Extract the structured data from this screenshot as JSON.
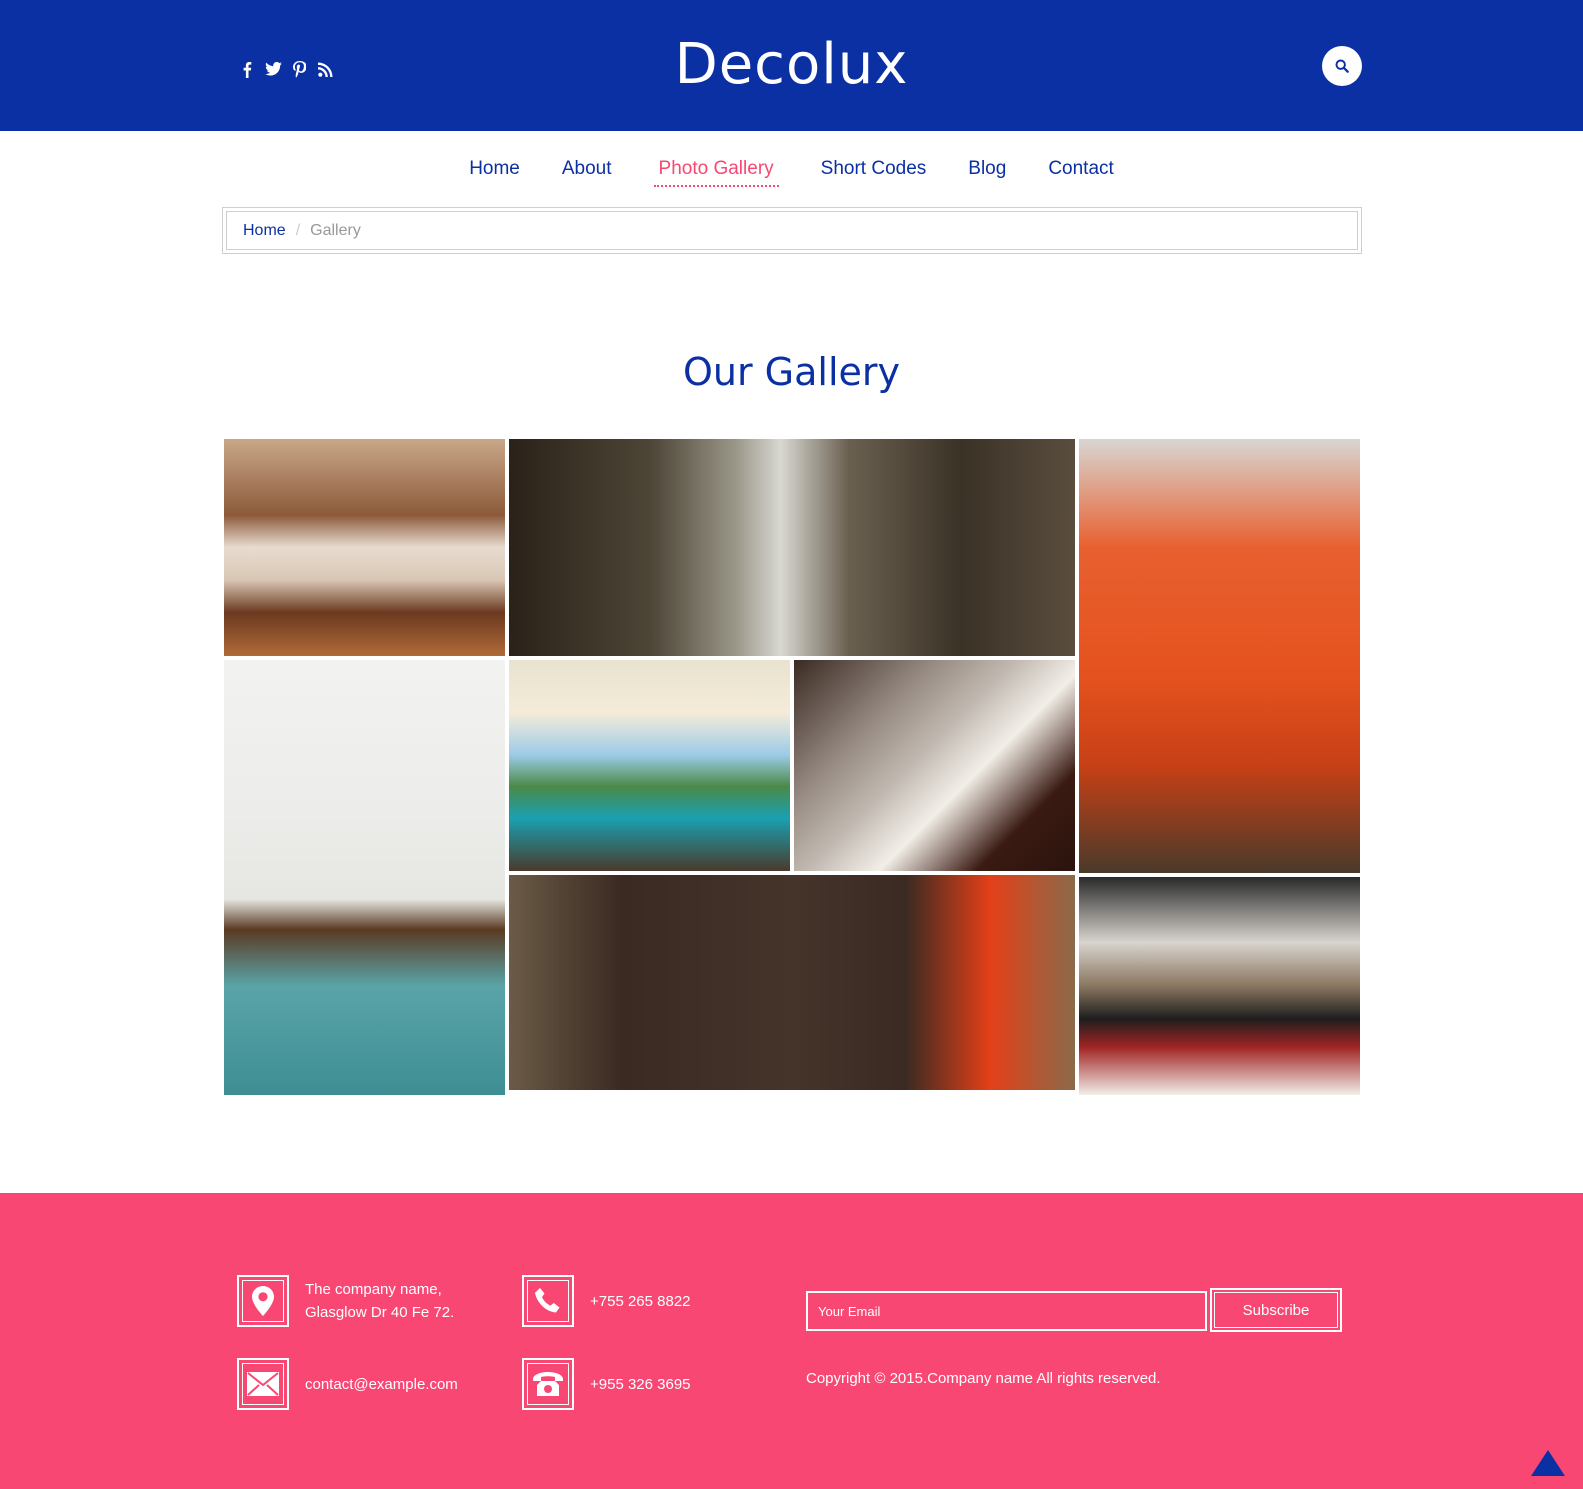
{
  "header": {
    "logo": "Decolux",
    "social": [
      "facebook-icon",
      "twitter-icon",
      "pinterest-icon",
      "rss-icon"
    ],
    "search_icon": "search-icon"
  },
  "nav": {
    "items": [
      {
        "label": "Home"
      },
      {
        "label": "About"
      },
      {
        "label": "Photo Gallery",
        "active": true
      },
      {
        "label": "Short Codes"
      },
      {
        "label": "Blog"
      },
      {
        "label": "Contact"
      }
    ]
  },
  "breadcrumb": {
    "home": "Home",
    "separator": "/",
    "current": "Gallery"
  },
  "gallery": {
    "title": "Our Gallery",
    "images": [
      "bedroom with four-poster bed",
      "cafe tables by window",
      "orange wingback armchair",
      "dining table with white chairs",
      "terrace cabana with sea view",
      "silver dish and glass ornaments",
      "brown leather sofa",
      "modern living room with piano"
    ]
  },
  "footer": {
    "address_line1": "The company name,",
    "address_line2": "Glasglow Dr 40 Fe 72.",
    "phone1": "+755 265 8822",
    "email": "contact@example.com",
    "phone2": "+955 326 3695",
    "email_placeholder": "Your Email",
    "subscribe_label": "Subscribe",
    "copyright": "Copyright © 2015.Company name All rights reserved."
  },
  "colors": {
    "primary": "#0a30a3",
    "accent": "#f94774",
    "white": "#ffffff"
  }
}
